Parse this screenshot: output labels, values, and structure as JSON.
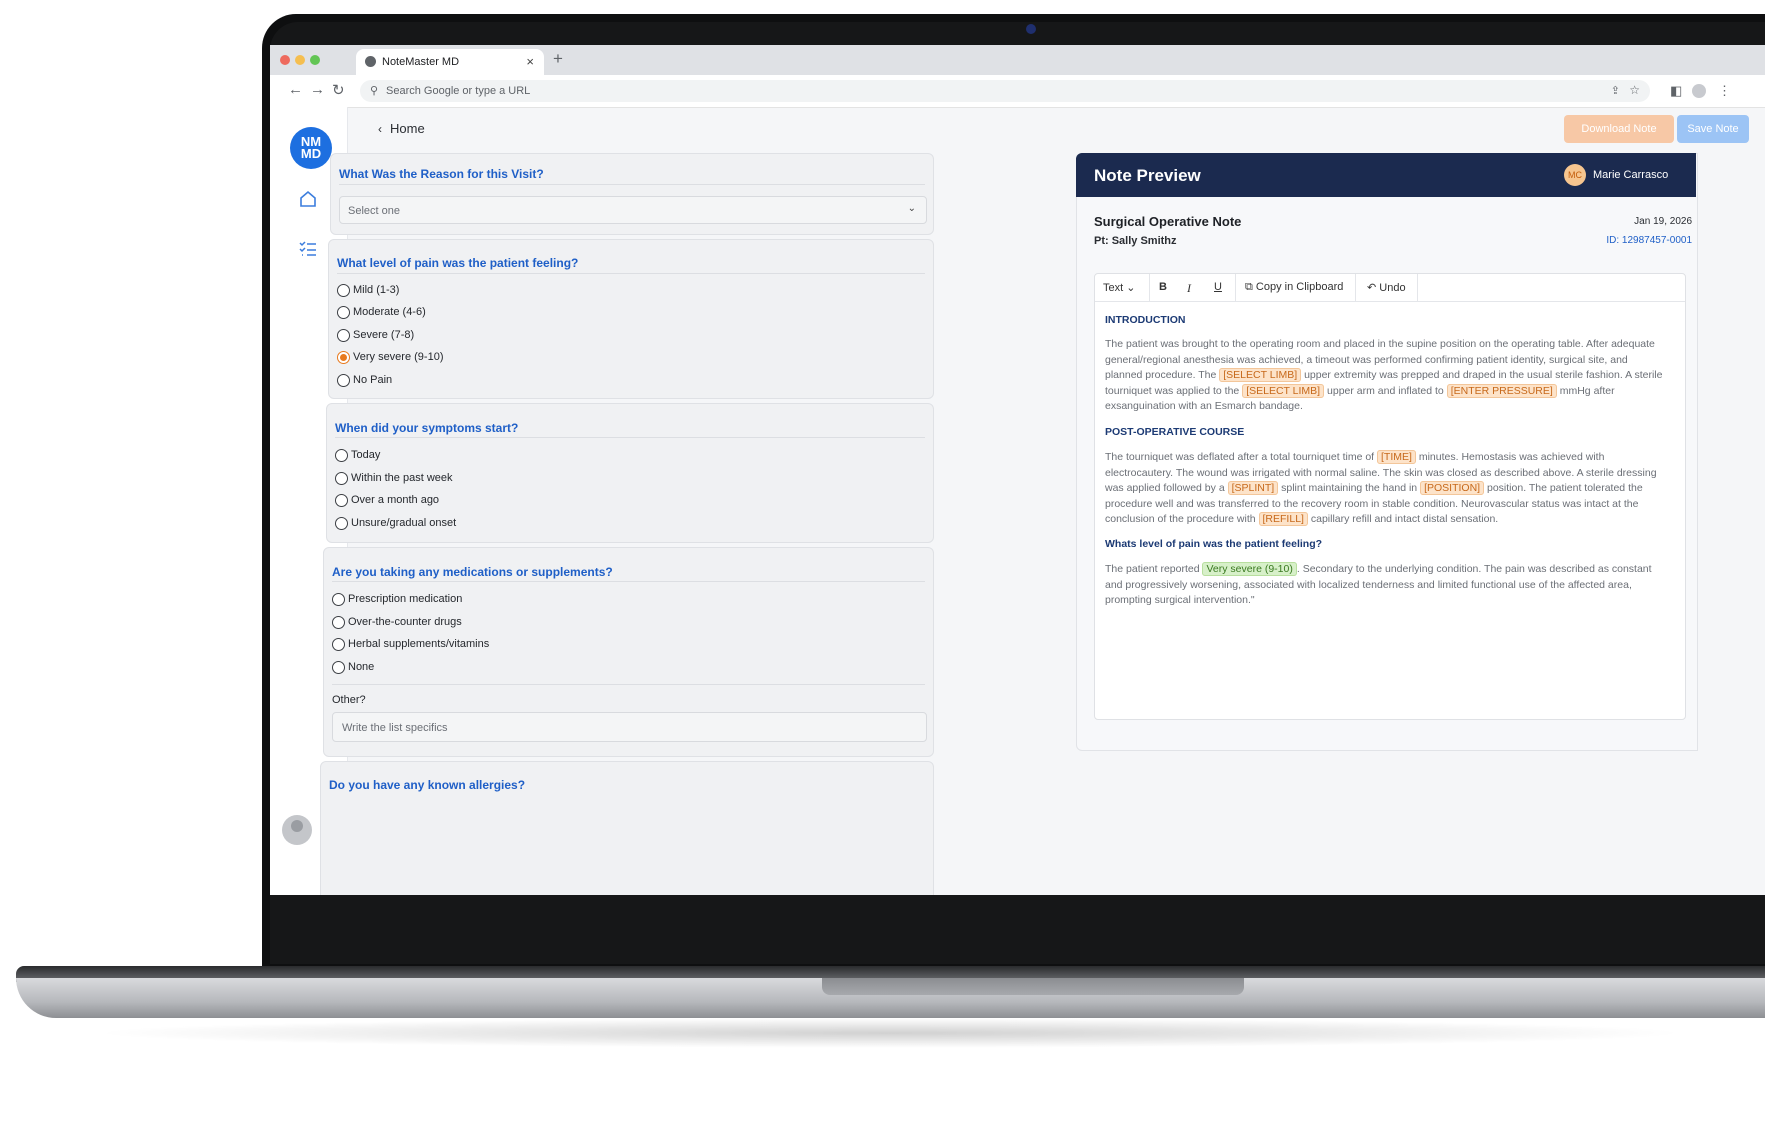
{
  "browser": {
    "tab_title": "NoteMaster MD",
    "tab_close": "×",
    "new_tab": "+",
    "url_placeholder": "Search Google or type a URL"
  },
  "sidebar": {
    "logo_line1": "NM",
    "logo_line2": "MD"
  },
  "header": {
    "back_label": "Home",
    "download_label": "Download Note",
    "save_label": "Save Note"
  },
  "form": {
    "reason": {
      "question": "What Was the Reason for this Visit?",
      "select_value": "Select one"
    },
    "pain": {
      "question": "What level of pain was the patient feeling?",
      "options": [
        "Mild (1-3)",
        "Moderate (4-6)",
        "Severe (7-8)",
        "Very severe (9-10)",
        "No Pain"
      ],
      "selected": "Very severe (9-10)"
    },
    "symptoms": {
      "question": "When did your symptoms start?",
      "options": [
        "Today",
        "Within the past week",
        "Over a month ago",
        "Unsure/gradual onset"
      ]
    },
    "medications": {
      "question": "Are you taking any medications or supplements?",
      "options": [
        "Prescription medication",
        "Over-the-counter drugs",
        "Herbal supplements/vitamins",
        "None"
      ],
      "other_label": "Other?",
      "other_placeholder": "Write the list specifics"
    },
    "allergies": {
      "question": "Do you have any known allergies?"
    }
  },
  "note_preview": {
    "title": "Note Preview",
    "user_initials": "MC",
    "user_name": "Marie Carrasco",
    "note_title": "Surgical Operative Note",
    "patient": "Pt: Sally Smithz",
    "date": "Jan 19, 2026",
    "note_id": "ID: 12987457-0001",
    "toolbar": {
      "text_label": "Text",
      "copy_label": "Copy in Clipboard",
      "undo_label": "Undo"
    },
    "sections": {
      "intro_heading": "INTRODUCTION",
      "intro_p1": "The patient was brought to the operating room and placed in the supine position on the operating table. After adequate general/regional anesthesia was achieved, a timeout was performed confirming patient identity, surgical site, and planned procedure. The",
      "intro_tag1": "[SELECT LIMB]",
      "intro_p2": "upper extremity was prepped and draped in the usual sterile fashion. A sterile tourniquet was applied to the",
      "intro_tag2": "[SELECT LIMB]",
      "intro_p3": "upper arm and inflated to",
      "intro_tag3": "[ENTER PRESSURE]",
      "intro_p4": "mmHg after exsanguination with an Esmarch bandage.",
      "postop_heading": "POST-OPERATIVE COURSE",
      "postop_p1": "The tourniquet was deflated after a total tourniquet time of",
      "postop_tag1": "[TIME]",
      "postop_p2": "minutes. Hemostasis was achieved with electrocautery. The wound was irrigated with normal saline. The skin was closed as described above. A sterile dressing was applied followed by a",
      "postop_tag2": "[SPLINT]",
      "postop_p3": "splint maintaining the hand in",
      "postop_tag3": "[POSITION]",
      "postop_p4": "position. The patient tolerated the procedure well and was transferred to the recovery room in stable condition. Neurovascular status was intact at the conclusion of the procedure with",
      "postop_tag4": "[REFILL]",
      "postop_p5": "capillary refill and intact distal sensation.",
      "pain_heading": "Whats level of pain was the patient feeling?",
      "pain_p1": "The patient reported",
      "pain_tag": "Very severe (9-10)",
      "pain_p2": ". Secondary to the underlying condition. The pain was described as constant and progressively worsening, associated with localized tenderness and limited functional use of the affected area, prompting surgical intervention.\""
    }
  },
  "colors": {
    "accent": "#1f5fc7",
    "note_header": "#1b2a4f",
    "download_btn": "#f7c8a6",
    "save_btn": "#9cc4f5",
    "placeholder_tag": "#fde3c9",
    "answer_tag": "#d7f0c9"
  },
  "icons": [
    "home-icon",
    "checklist-icon",
    "back-chevron-icon",
    "chevron-down-icon",
    "bold-icon",
    "italic-icon",
    "underline-icon",
    "copy-icon",
    "undo-icon",
    "search-icon",
    "reload-icon",
    "star-icon",
    "share-icon",
    "profile-icon"
  ]
}
